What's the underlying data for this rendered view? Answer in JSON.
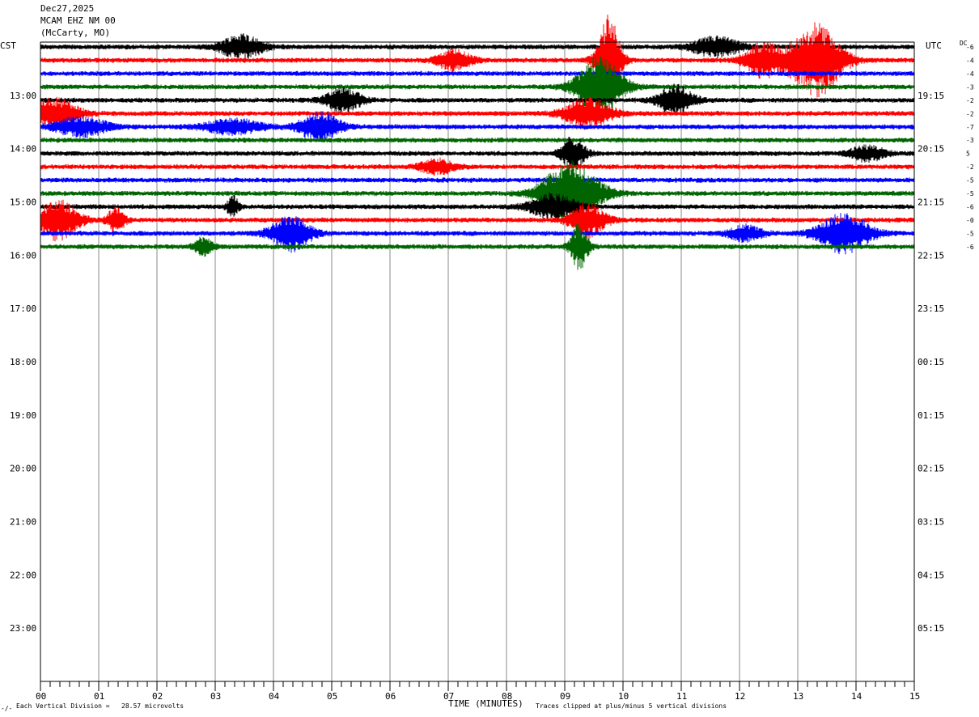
{
  "header": {
    "date": "Dec27,2025",
    "station": "MCAM EHZ NM 00",
    "location": "(McCarty, MO)"
  },
  "labels": {
    "left_tz": "CST",
    "right_tz": "UTC",
    "dc": "DC",
    "xaxis_title": "TIME (MINUTES)",
    "scale_note": "Each Vertical Division =   28.57 microvolts",
    "clip_note": "Traces clipped at plus/minus 5 vertical divisions",
    "corner_mark": "-∕-"
  },
  "chart_data": {
    "type": "helicorder",
    "x_ticks": [
      "00",
      "01",
      "02",
      "03",
      "04",
      "05",
      "06",
      "07",
      "08",
      "09",
      "10",
      "11",
      "12",
      "13",
      "14",
      "15"
    ],
    "x_range": [
      0,
      15
    ],
    "left_hour_labels": [
      "13:00",
      "14:00",
      "15:00",
      "16:00",
      "17:00",
      "18:00",
      "19:00",
      "20:00",
      "21:00",
      "22:00",
      "23:00"
    ],
    "right_hour_labels": [
      "19:15",
      "20:15",
      "21:15",
      "22:15",
      "23:15",
      "00:15",
      "01:15",
      "02:15",
      "03:15",
      "04:15",
      "05:15"
    ],
    "traces": [
      {
        "color": "#000000",
        "dc": "-6"
      },
      {
        "color": "#ff0000",
        "dc": "-4"
      },
      {
        "color": "#0000ff",
        "dc": "-4"
      },
      {
        "color": "#006400",
        "dc": "-3"
      },
      {
        "color": "#000000",
        "dc": "-2"
      },
      {
        "color": "#ff0000",
        "dc": "-2"
      },
      {
        "color": "#0000ff",
        "dc": "-7"
      },
      {
        "color": "#006400",
        "dc": "-3"
      },
      {
        "color": "#000000",
        "dc": "5"
      },
      {
        "color": "#ff0000",
        "dc": "-2"
      },
      {
        "color": "#0000ff",
        "dc": "-5"
      },
      {
        "color": "#006400",
        "dc": "-5"
      },
      {
        "color": "#000000",
        "dc": "-6"
      },
      {
        "color": "#ff0000",
        "dc": "-0"
      },
      {
        "color": "#0000ff",
        "dc": "-5"
      },
      {
        "color": "#006400",
        "dc": "-6"
      }
    ],
    "events": [
      {
        "trace": 0,
        "minute": 3.45,
        "amp": 2.5,
        "width": 0.35
      },
      {
        "trace": 0,
        "minute": 11.6,
        "amp": 2.0,
        "width": 0.4
      },
      {
        "trace": 1,
        "minute": 12.4,
        "amp": 3.5,
        "width": 0.3
      },
      {
        "trace": 1,
        "minute": 13.3,
        "amp": 7.5,
        "width": 0.45
      },
      {
        "trace": 1,
        "minute": 9.75,
        "amp": 9.0,
        "width": 0.2
      },
      {
        "trace": 1,
        "minute": 7.1,
        "amp": 2.0,
        "width": 0.3
      },
      {
        "trace": 3,
        "minute": 9.6,
        "amp": 6.0,
        "width": 0.4
      },
      {
        "trace": 4,
        "minute": 5.2,
        "amp": 2.5,
        "width": 0.3
      },
      {
        "trace": 4,
        "minute": 10.9,
        "amp": 3.0,
        "width": 0.3
      },
      {
        "trace": 5,
        "minute": 0.25,
        "amp": 3.0,
        "width": 0.4
      },
      {
        "trace": 5,
        "minute": 9.4,
        "amp": 3.0,
        "width": 0.4
      },
      {
        "trace": 6,
        "minute": 0.7,
        "amp": 2.0,
        "width": 0.45
      },
      {
        "trace": 6,
        "minute": 3.3,
        "amp": 1.5,
        "width": 0.5
      },
      {
        "trace": 6,
        "minute": 4.8,
        "amp": 3.0,
        "width": 0.35
      },
      {
        "trace": 8,
        "minute": 9.15,
        "amp": 3.5,
        "width": 0.2
      },
      {
        "trace": 8,
        "minute": 14.2,
        "amp": 1.5,
        "width": 0.3
      },
      {
        "trace": 9,
        "minute": 6.8,
        "amp": 1.5,
        "width": 0.3
      },
      {
        "trace": 11,
        "minute": 9.1,
        "amp": 6.5,
        "width": 0.5
      },
      {
        "trace": 12,
        "minute": 8.8,
        "amp": 2.5,
        "width": 0.4
      },
      {
        "trace": 12,
        "minute": 3.3,
        "amp": 2.0,
        "width": 0.1
      },
      {
        "trace": 13,
        "minute": 0.3,
        "amp": 4.0,
        "width": 0.35
      },
      {
        "trace": 13,
        "minute": 1.3,
        "amp": 2.5,
        "width": 0.15
      },
      {
        "trace": 13,
        "minute": 9.4,
        "amp": 3.5,
        "width": 0.3
      },
      {
        "trace": 14,
        "minute": 4.3,
        "amp": 3.5,
        "width": 0.35
      },
      {
        "trace": 14,
        "minute": 13.8,
        "amp": 4.0,
        "width": 0.45
      },
      {
        "trace": 14,
        "minute": 12.1,
        "amp": 1.5,
        "width": 0.3
      },
      {
        "trace": 15,
        "minute": 9.25,
        "amp": 4.5,
        "width": 0.15
      },
      {
        "trace": 15,
        "minute": 2.8,
        "amp": 2.0,
        "width": 0.15
      }
    ]
  }
}
